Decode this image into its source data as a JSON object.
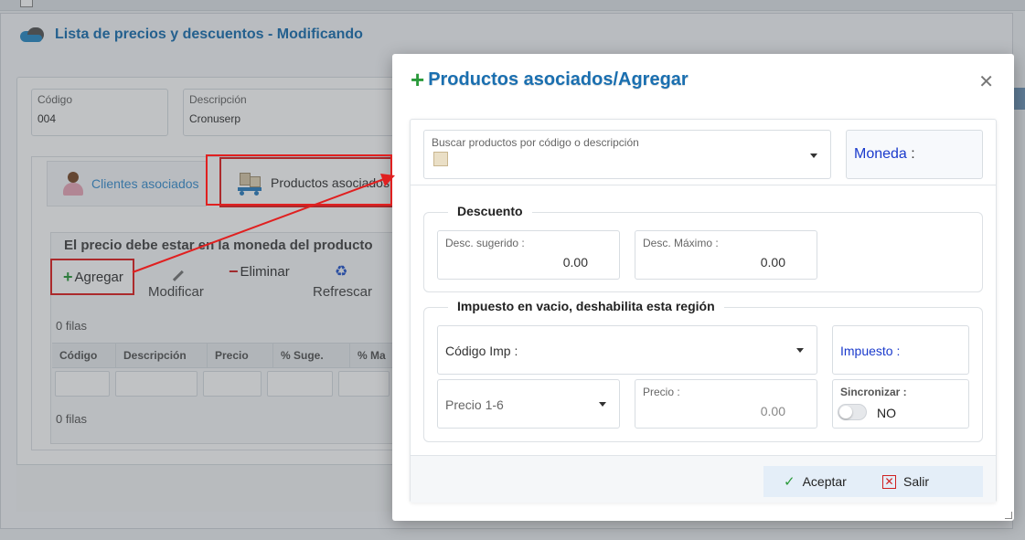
{
  "background": {
    "window_title": "Lista de precios y descuentos - Modificando",
    "codigo": {
      "label": "Código",
      "value": "004"
    },
    "descripcion": {
      "label": "Descripción",
      "value": "Cronuserp"
    },
    "tabs": [
      {
        "label": "Clientes asociados"
      },
      {
        "label": "Productos asociados"
      }
    ],
    "note": "El precio debe estar en la moneda del producto",
    "toolbar": {
      "agregar": "Agregar",
      "modificar": "Modificar",
      "eliminar": "Eliminar",
      "refrescar": "Refrescar"
    },
    "rows_top": "0 filas",
    "rows_bottom": "0 filas",
    "columns": [
      "Código",
      "Descripción",
      "Precio",
      "% Suge.",
      "% Ma"
    ]
  },
  "modal": {
    "title": "Productos asociados/Agregar",
    "search": {
      "placeholder": "Buscar productos por código o descripción"
    },
    "moneda": {
      "label": "Moneda",
      "colon": ":"
    },
    "descuento": {
      "legend": "Descuento",
      "sugerido": {
        "label": "Desc. sugerido :",
        "value": "0.00"
      },
      "maximo": {
        "label": "Desc. Máximo :",
        "value": "0.00"
      }
    },
    "impuesto": {
      "legend": "Impuesto en vacio, deshabilita esta región",
      "codigo_imp": "Código Imp :",
      "impuesto_label": "Impuesto :",
      "precio_select": "Precio 1-6",
      "precio": {
        "label": "Precio :",
        "value": "0.00"
      },
      "sincronizar": {
        "label": "Sincronizar :",
        "state": "NO"
      }
    },
    "buttons": {
      "aceptar": "Aceptar",
      "salir": "Salir"
    }
  },
  "colors": {
    "accent_blue": "#1a6fb0",
    "highlight_red": "#e02020",
    "add_green": "#2a9a3a"
  }
}
